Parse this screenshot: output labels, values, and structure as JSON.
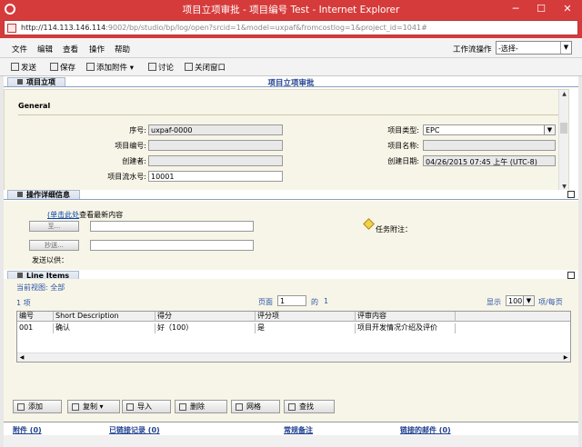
{
  "window": {
    "title": "项目立项审批 - 项目编号 Test - Internet Explorer",
    "url_host": "http://114.113.146.114",
    "url_path": ":9002/bp/studio/bp/log/open?srcid=1&model=uxpaf&fromcostlog=1&project_id=1041#"
  },
  "menu": {
    "items": [
      "文件",
      "编辑",
      "查看",
      "操作",
      "帮助"
    ],
    "workflow_label": "工作流操作",
    "workflow_value": "-选择-"
  },
  "toolbar": {
    "send": "发送",
    "save": "保存",
    "attach": "添加附件",
    "discuss": "讨论",
    "close": "关闭窗口"
  },
  "project": {
    "tab": "项目立项",
    "heading": "项目立项审批",
    "general_label": "General",
    "fields": {
      "seq_label": "序号:",
      "seq_value": "uxpaf-0000",
      "projno_label": "项目编号:",
      "projno_value": "",
      "creator_label": "创建者:",
      "creator_value": "",
      "flow_label": "项目流水号:",
      "flow_value": "10001",
      "type_label": "项目类型:",
      "type_value": "EPC",
      "name_label": "项目名称:",
      "name_value": "",
      "date_label": "创建日期:",
      "date_value": "04/26/2015 07:45 上午 (UTC-8)"
    }
  },
  "ops": {
    "tab": "操作详细信息",
    "link_text": "(单击此处",
    "link_tail": "查看最新内容",
    "to_btn": "至...",
    "cc_btn": "抄送...",
    "send_for": "发送以供：",
    "task_note": "任务附注："
  },
  "line_items": {
    "tab": "Line Items",
    "current_view": "当前视图: 全部",
    "count": "1 项",
    "page_label": "页面",
    "page_value": "1",
    "of_label": "的",
    "of_value": "1",
    "show_label": "显示",
    "show_value": "100",
    "per_page": "项/每页",
    "columns": [
      "编号",
      "Short Description",
      "得分",
      "评分项",
      "评审内容"
    ],
    "rows": [
      [
        "001",
        "确认",
        "好（100）",
        "是",
        "项目开发情况介绍及评价"
      ]
    ]
  },
  "actions": {
    "add": "添加",
    "copy": "复制",
    "import": "导入",
    "delete": "删除",
    "grid": "网格",
    "find": "查找"
  },
  "footer": {
    "attachments": "附件 (0)",
    "linked_records": "已链接记录 (0)",
    "notes": "常规备注",
    "linked_mail": "链接的邮件 (0)"
  },
  "colors": {
    "title_bar": "#d63b3b",
    "form_bg": "#f7f5e7",
    "link": "#1f3f8f"
  }
}
